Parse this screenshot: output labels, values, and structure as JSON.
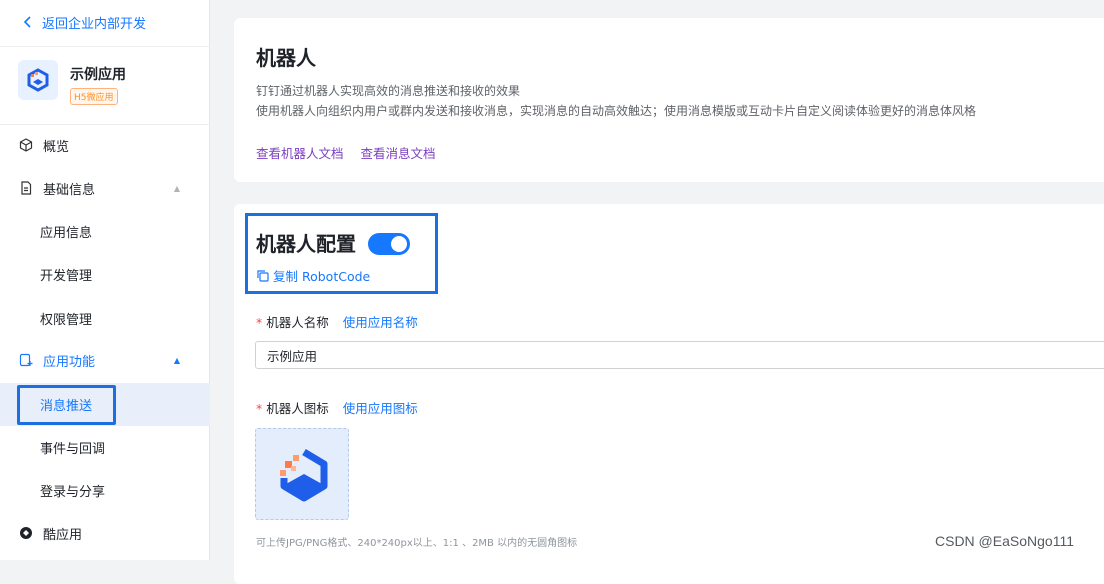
{
  "sidebar": {
    "back_label": "返回企业内部开发",
    "app_name": "示例应用",
    "app_tag": "H5微应用",
    "items": [
      {
        "label": "概览"
      },
      {
        "label": "基础信息"
      },
      {
        "label": "应用信息"
      },
      {
        "label": "开发管理"
      },
      {
        "label": "权限管理"
      },
      {
        "label": "应用功能"
      },
      {
        "label": "消息推送"
      },
      {
        "label": "事件与回调"
      },
      {
        "label": "登录与分享"
      },
      {
        "label": "酷应用"
      }
    ]
  },
  "intro": {
    "title": "机器人",
    "desc1": "钉钉通过机器人实现高效的消息推送和接收的效果",
    "desc2": "使用机器人向组织内用户或群内发送和接收消息，实现消息的自动高效触达；使用消息模版或互动卡片自定义阅读体验更好的消息体风格",
    "link_robot_doc": "查看机器人文档",
    "link_msg_doc": "查看消息文档"
  },
  "config": {
    "title": "机器人配置",
    "toggle_on": true,
    "copy_label": "复制 RobotCode",
    "name_label": "机器人名称",
    "name_alt": "使用应用名称",
    "name_value": "示例应用",
    "icon_label": "机器人图标",
    "icon_alt": "使用应用图标",
    "upload_hint": "可上传JPG/PNG格式、240*240px以上、1:1 、2MB 以内的无圆角图标"
  },
  "watermark": "CSDN @EaSoNgo111",
  "colors": {
    "accent": "#1677ff",
    "highlight": "#1c6fe0",
    "link_purple": "#7b3fc0",
    "required": "#f54a45"
  }
}
